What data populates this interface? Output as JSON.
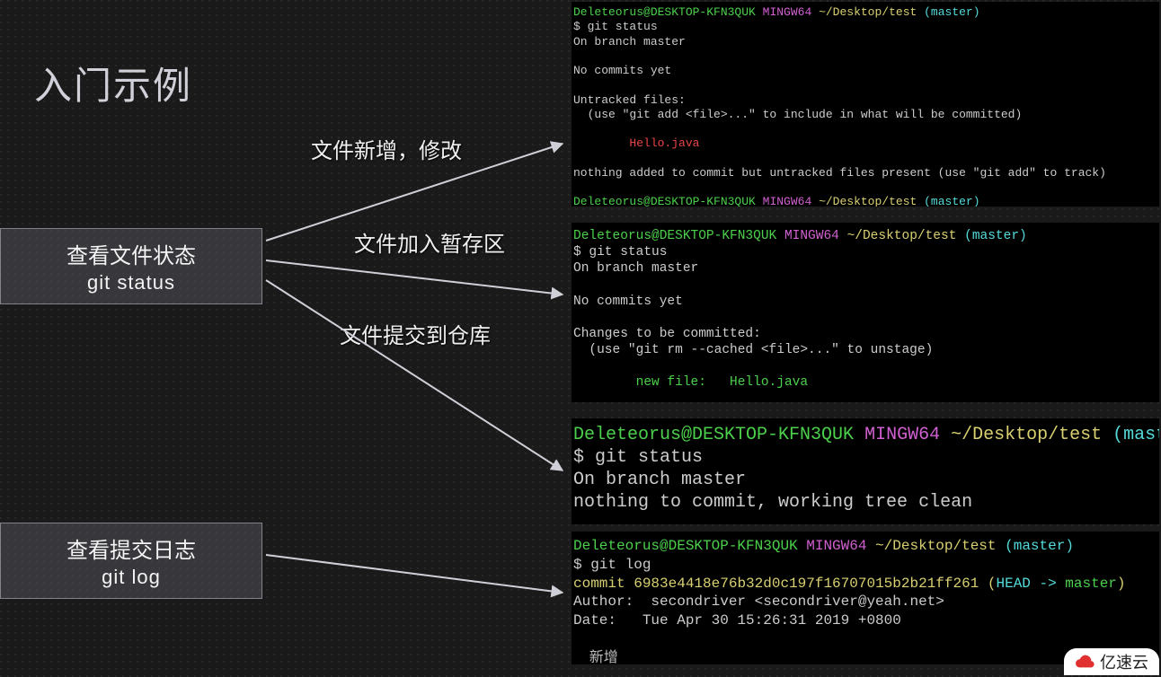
{
  "title": "入门示例",
  "boxes": {
    "status": {
      "title": "查看文件状态",
      "cmd": "git status"
    },
    "log": {
      "title": "查看提交日志",
      "cmd": "git  log"
    }
  },
  "labels": {
    "l1": "文件新增，修改",
    "l2": "文件加入暂存区",
    "l3": "文件提交到仓库"
  },
  "term1": {
    "prompt_user": "Deleteorus@DESKTOP-KFN3QUK",
    "prompt_sys": "MINGW64",
    "prompt_path": "~/Desktop/test",
    "prompt_branch": "master",
    "cmd": "$ git status",
    "l1": "On branch master",
    "l2": "No commits yet",
    "l3": "Untracked files:",
    "l4": "  (use \"git add <file>...\" to include in what will be committed)",
    "file": "        Hello.java",
    "l5": "nothing added to commit but untracked files present (use \"git add\" to track)",
    "cursor": "$ |"
  },
  "term2": {
    "prompt_user": "Deleteorus@DESKTOP-KFN3QUK",
    "prompt_sys": "MINGW64",
    "prompt_path": "~/Desktop/test",
    "prompt_branch": "master",
    "cmd": "$ git status",
    "l1": "On branch master",
    "l2": "No commits yet",
    "l3": "Changes to be committed:",
    "l4": "  (use \"git rm --cached <file>...\" to unstage)",
    "file": "        new file:   Hello.java"
  },
  "term3": {
    "prompt_user": "Deleteorus@DESKTOP-KFN3QUK",
    "prompt_sys": "MINGW64",
    "prompt_path": "~/Desktop/test",
    "prompt_branch": "master",
    "cmd": "$ git status",
    "l1": "On branch master",
    "l2": "nothing to commit, working tree clean"
  },
  "term4": {
    "prompt_user": "Deleteorus@DESKTOP-KFN3QUK",
    "prompt_sys": "MINGW64",
    "prompt_path": "~/Desktop/test",
    "prompt_branch": "master",
    "cmd": "$ git log",
    "commit_pre": "commit ",
    "commit_hash": "6983e4418e76b32d0c197f16707015b2b21ff261",
    "head_open": " (",
    "head_label": "HEAD -> ",
    "head_branch": "master",
    "head_close": ")",
    "author": "Author:  secondriver <secondriver@yeah.net>",
    "date": "Date:   Tue Apr 30 15:26:31 2019 +0800",
    "msg": "    新增"
  },
  "watermark": "亿速云"
}
